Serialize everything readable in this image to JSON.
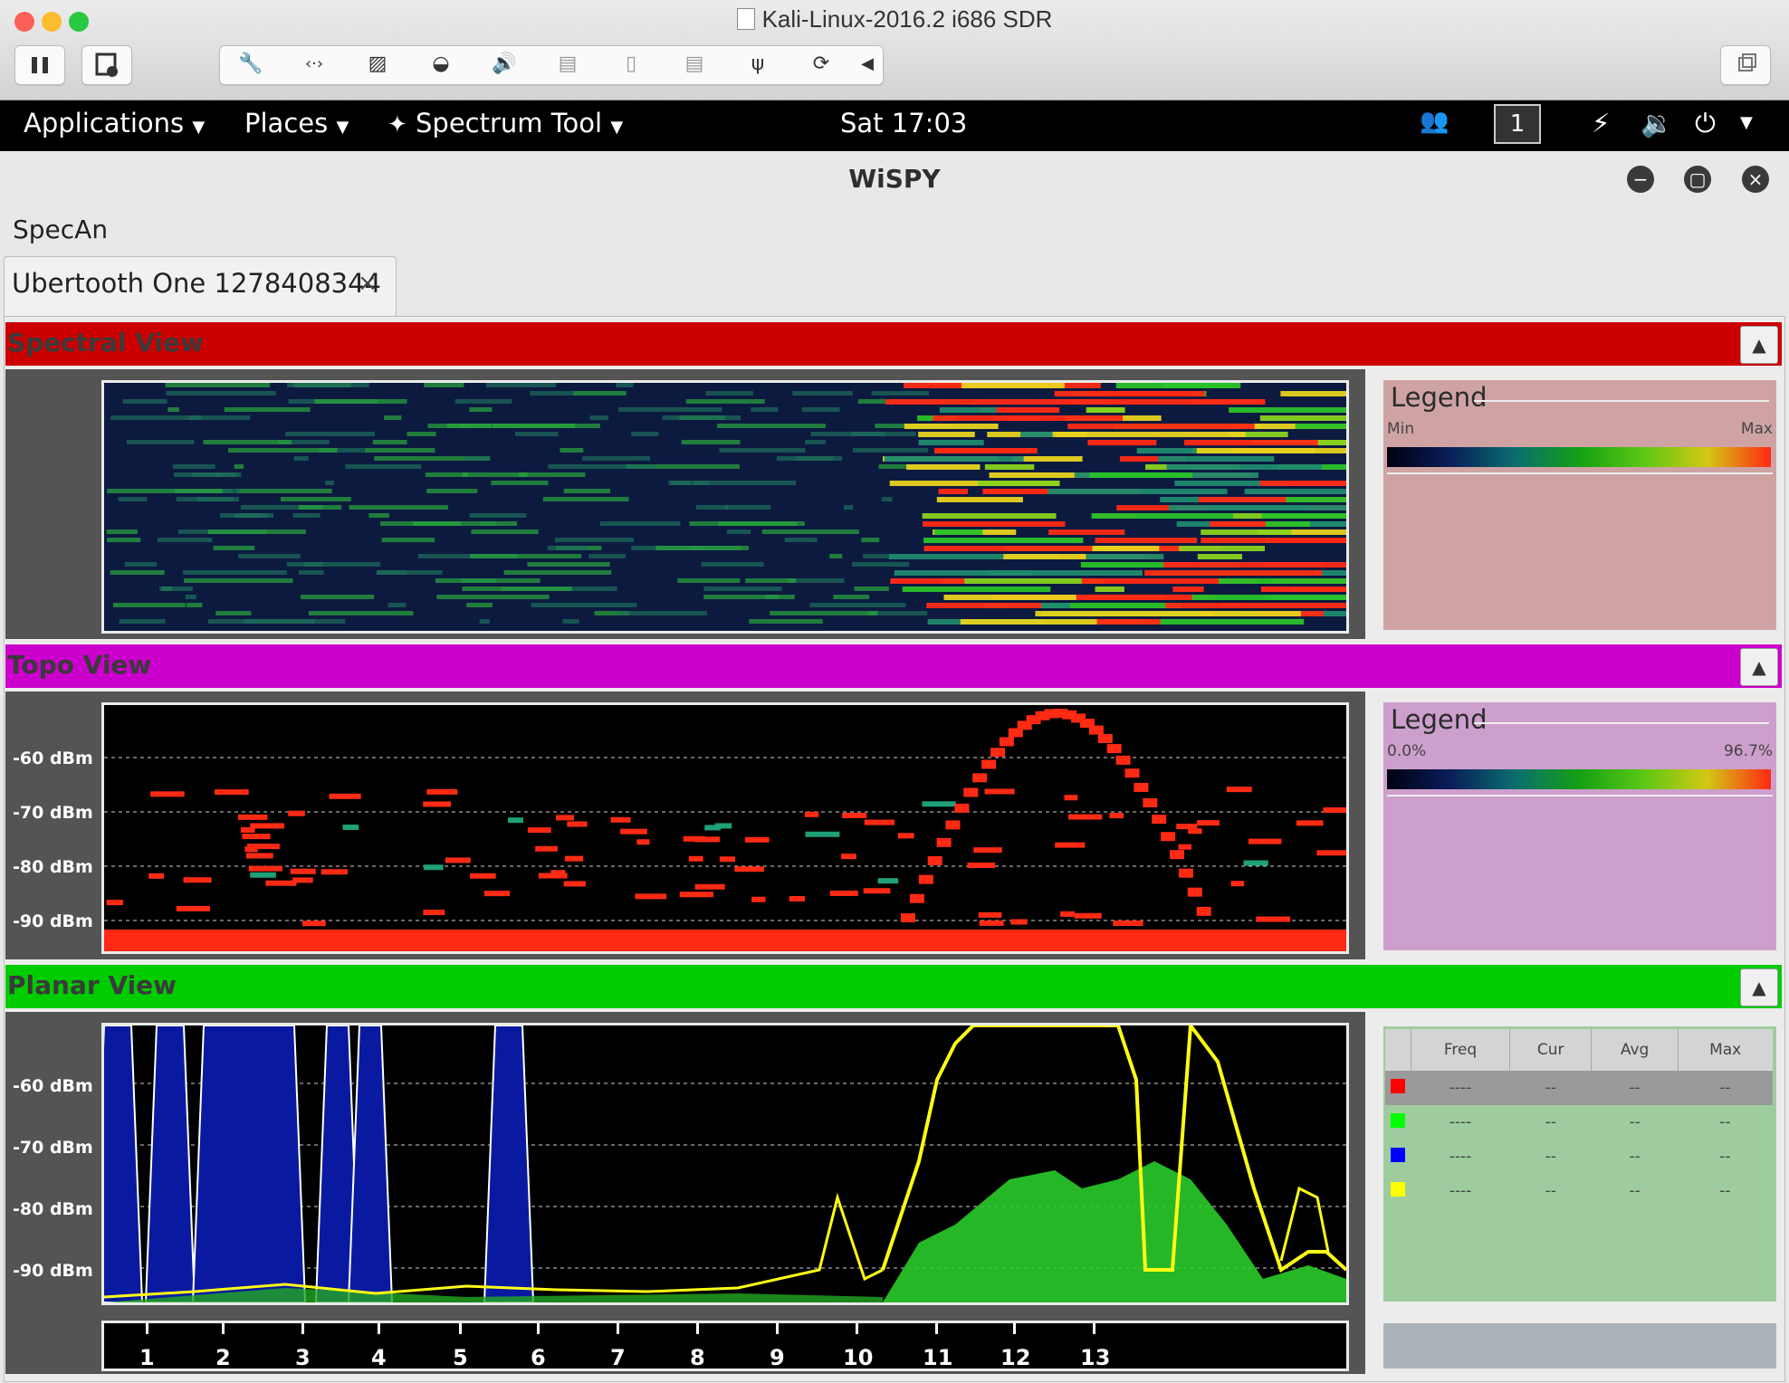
{
  "host_window": {
    "title": "Kali-Linux-2016.2 i686 SDR",
    "toolbar_icons": [
      "pause-icon",
      "snapshot-icon",
      "wrench-icon",
      "network-arrows-icon",
      "harddisk-icon",
      "optical-disk-icon",
      "speaker-icon",
      "usb-device-icon",
      "mouse-icon",
      "usb-device-icon",
      "usb-icon",
      "refresh-icon",
      "chevron-left-icon",
      "window-restore-icon"
    ]
  },
  "gnome_bar": {
    "applications": "Applications",
    "places": "Places",
    "spectrum_tool": "Spectrum Tool",
    "clock": "Sat 17:03",
    "workspace": "1"
  },
  "app": {
    "title": "WiSPY",
    "menu": "SpecAn",
    "tab_label": "Ubertooth One 1278408344",
    "tab_close": "×",
    "collapse_symbol": "▲"
  },
  "spectral": {
    "title": "Spectral View",
    "bar_color": "#cc0000",
    "legend": {
      "title": "Legend",
      "min": "Min",
      "max": "Max"
    }
  },
  "topo": {
    "title": "Topo View",
    "bar_color": "#cc00cc",
    "dbm_labels": [
      "-60 dBm",
      "-70 dBm",
      "-80 dBm",
      "-90 dBm"
    ],
    "legend": {
      "title": "Legend",
      "min": "0.0%",
      "max": "96.7%"
    }
  },
  "planar": {
    "title": "Planar View",
    "bar_color": "#00cc00",
    "dbm_labels": [
      "-60 dBm",
      "-70 dBm",
      "-80 dBm",
      "-90 dBm"
    ],
    "table": {
      "headers": [
        "Freq",
        "Cur",
        "Avg",
        "Max"
      ],
      "rows": [
        {
          "color": "#ff0000",
          "freq": "----",
          "cur": "--",
          "avg": "--",
          "max": "--"
        },
        {
          "color": "#00ff00",
          "freq": "----",
          "cur": "--",
          "avg": "--",
          "max": "--"
        },
        {
          "color": "#0000ff",
          "freq": "----",
          "cur": "--",
          "avg": "--",
          "max": "--"
        },
        {
          "color": "#ffff00",
          "freq": "----",
          "cur": "--",
          "avg": "--",
          "max": "--"
        }
      ]
    }
  },
  "channels": [
    "1",
    "2",
    "3",
    "4",
    "5",
    "6",
    "7",
    "8",
    "9",
    "10",
    "11",
    "12",
    "13"
  ]
}
